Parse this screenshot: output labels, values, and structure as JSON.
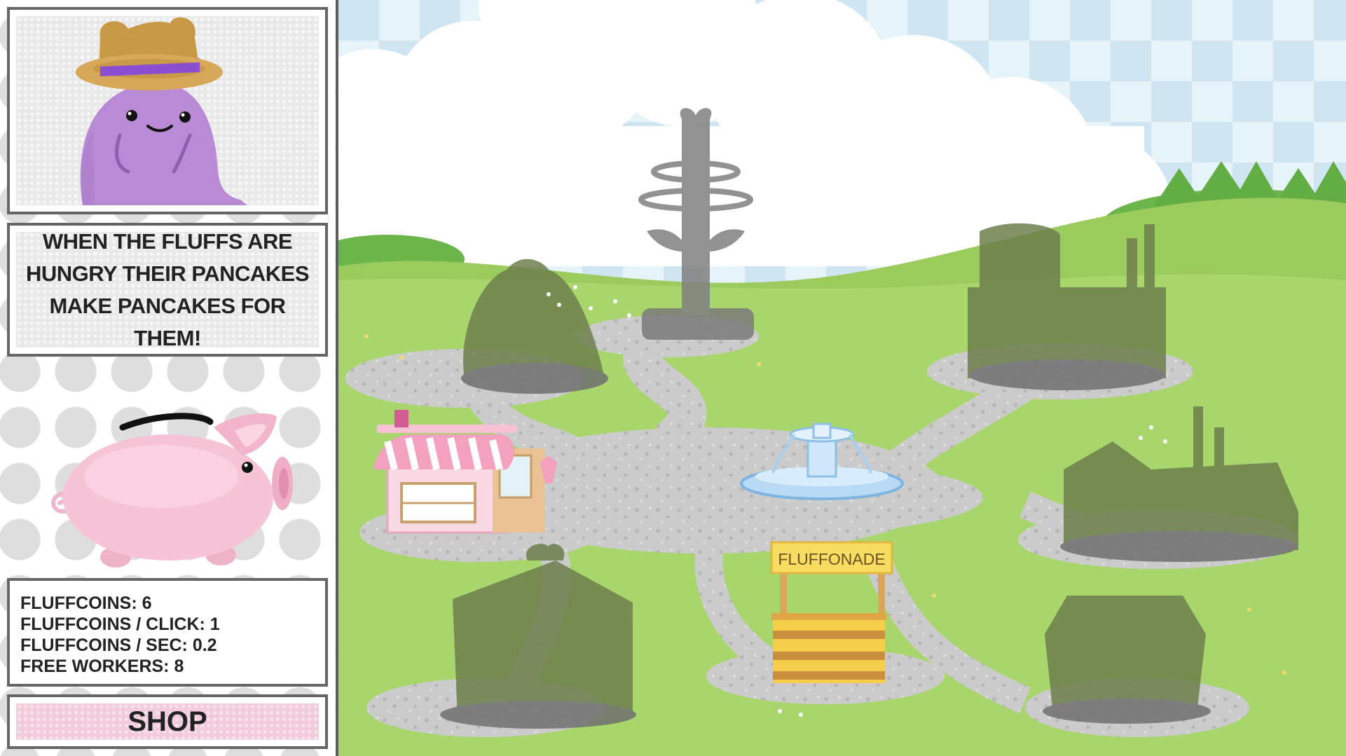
{
  "sidebar": {
    "character": {
      "name": "purple-fluff",
      "hat": "straw-hat"
    },
    "message": "WHEN THE FLUFFS ARE HUNGRY THEIR PANCAKES MAKE PANCAKES FOR THEM!",
    "stats": {
      "coins": "FLUFFCOINS: 6",
      "per_click": "FLUFFCOINS / CLICK: 1",
      "per_sec": "FLUFFCOINS / SEC: 0.2",
      "free_workers": "FREE WORKERS: 8"
    },
    "shop_label": "SHOP"
  },
  "map": {
    "stand_sign": "FLUFFONADE"
  },
  "colors": {
    "grass": "#a6d469",
    "path": "#c9c9c9",
    "silhouette": "#6e7f4c",
    "sky_check": "#cde6f2",
    "shop_pink": "#f2cbdc",
    "border": "#666666"
  }
}
